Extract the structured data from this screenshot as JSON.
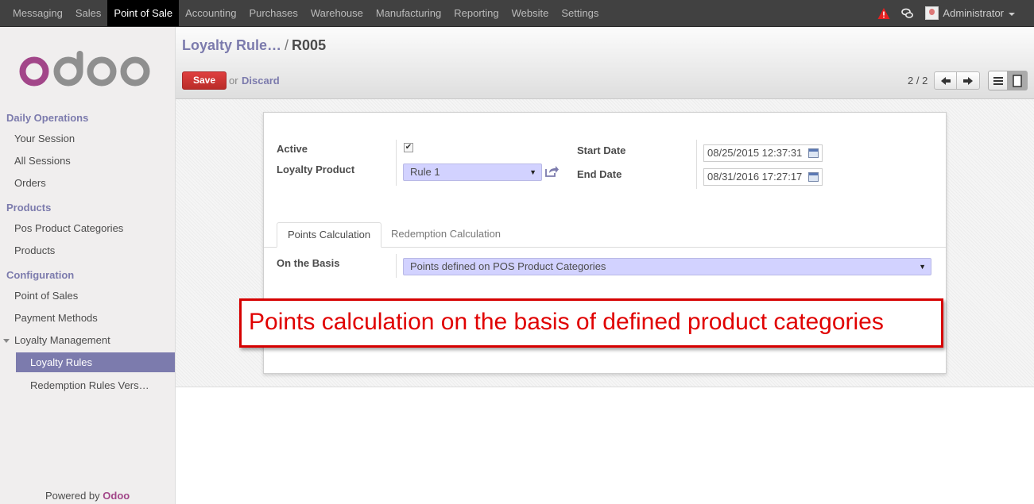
{
  "topbar": {
    "menu": [
      "Messaging",
      "Sales",
      "Point of Sale",
      "Accounting",
      "Purchases",
      "Warehouse",
      "Manufacturing",
      "Reporting",
      "Website",
      "Settings"
    ],
    "active_menu": "Point of Sale",
    "user": "Administrator"
  },
  "sidebar": {
    "logo": "odoo",
    "sections": [
      {
        "title": "Daily Operations",
        "items": [
          "Your Session",
          "All Sessions",
          "Orders"
        ]
      },
      {
        "title": "Products",
        "items": [
          "Pos Product Categories",
          "Products"
        ]
      },
      {
        "title": "Configuration",
        "items": [
          "Point of Sales",
          "Payment Methods",
          "Loyalty Management"
        ]
      }
    ],
    "loyalty_sub": [
      "Loyalty Rules",
      "Redemption Rules Vers…"
    ],
    "powered_prefix": "Powered by ",
    "powered_brand": "Odoo"
  },
  "control": {
    "breadcrumb_link": "Loyalty Rule…",
    "breadcrumb_sep": "/",
    "breadcrumb_current": "R005",
    "save_label": "Save",
    "or_label": "or",
    "discard_label": "Discard",
    "pager": "2 / 2"
  },
  "form": {
    "active_label": "Active",
    "active_value": "✔",
    "loyalty_product_label": "Loyalty Product",
    "loyalty_product_value": "Rule 1",
    "start_date_label": "Start Date",
    "start_date_value": "08/25/2015 12:37:31",
    "end_date_label": "End Date",
    "end_date_value": "08/31/2016 17:27:17",
    "tabs": [
      "Points Calculation",
      "Redemption Calculation"
    ],
    "basis_label": "On the Basis",
    "basis_value": "Points defined on POS Product Categories"
  },
  "annotation": "Points calculation on the basis of defined product categories",
  "colors": {
    "brand": "#7c7bad",
    "save": "#c9302c",
    "annotation": "#e00000"
  }
}
